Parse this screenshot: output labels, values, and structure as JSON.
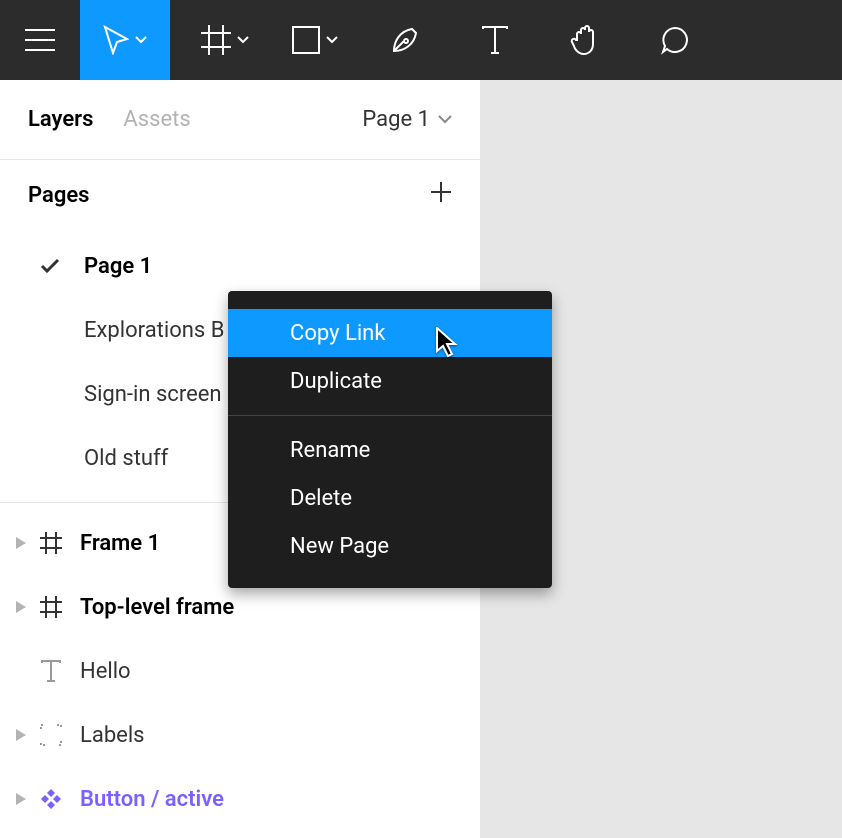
{
  "toolbar": {
    "tools": [
      "move",
      "frame",
      "shape",
      "pen",
      "text",
      "hand",
      "comment"
    ]
  },
  "panel": {
    "tabs": {
      "layers": "Layers",
      "assets": "Assets"
    },
    "page_switch": "Page 1"
  },
  "pages": {
    "header": "Pages",
    "items": [
      {
        "name": "Page 1",
        "current": true
      },
      {
        "name": "Explorations B",
        "current": false
      },
      {
        "name": "Sign-in screen",
        "current": false
      },
      {
        "name": "Old stuff",
        "current": false
      }
    ]
  },
  "layers": [
    {
      "name": "Frame 1",
      "icon": "frame",
      "bold": true,
      "expandable": true
    },
    {
      "name": "Top-level frame",
      "icon": "frame",
      "bold": true,
      "expandable": true
    },
    {
      "name": "Hello",
      "icon": "text",
      "bold": false,
      "expandable": false
    },
    {
      "name": "Labels",
      "icon": "group",
      "bold": false,
      "expandable": true
    },
    {
      "name": "Button / active",
      "icon": "component",
      "bold": false,
      "expandable": true,
      "component": true
    }
  ],
  "context_menu": {
    "items1": [
      {
        "label": "Copy Link",
        "highlight": true
      },
      {
        "label": "Duplicate",
        "highlight": false
      }
    ],
    "items2": [
      {
        "label": "Rename"
      },
      {
        "label": "Delete"
      },
      {
        "label": "New Page"
      }
    ]
  }
}
